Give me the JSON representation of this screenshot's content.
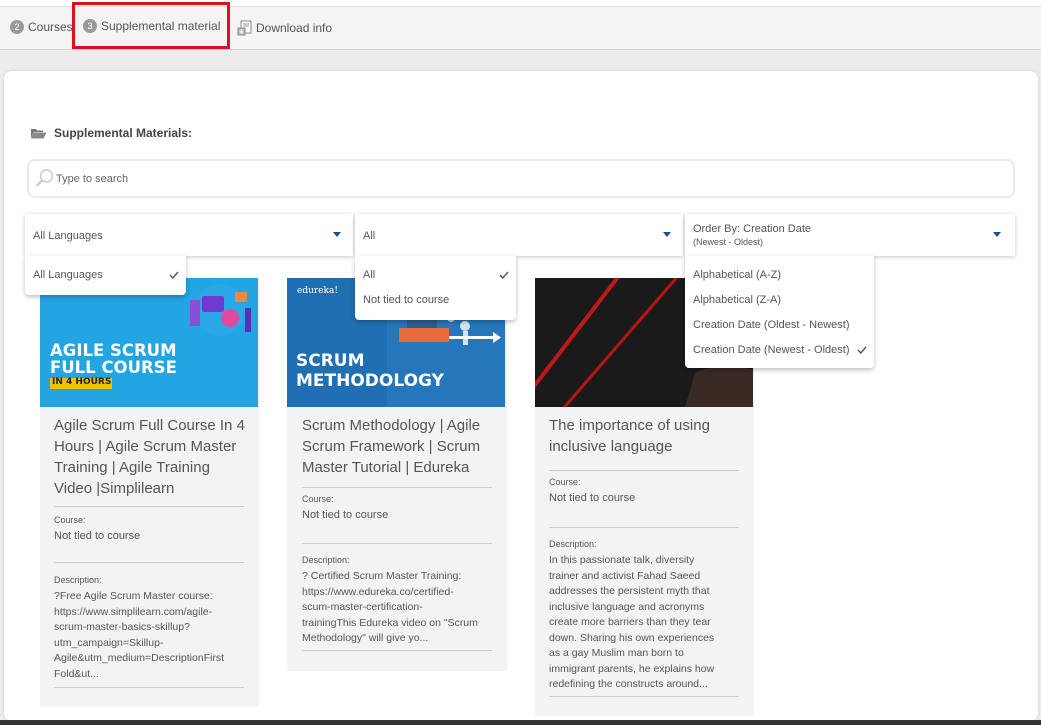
{
  "breadcrumb": {
    "steps": [
      {
        "num": "2",
        "label": "Courses"
      },
      {
        "num": "3",
        "label": "Supplemental material"
      },
      {
        "label": "Download info"
      }
    ]
  },
  "section": {
    "title": "Supplemental Materials:"
  },
  "search": {
    "placeholder": "Type to search"
  },
  "filters": {
    "language": {
      "selected": "All Languages",
      "options": [
        "All Languages"
      ]
    },
    "course": {
      "selected": "All",
      "options": [
        "All",
        "Not tied to course"
      ]
    },
    "order": {
      "selected": "Order By: Creation Date",
      "selected_sub": "(Newest - Oldest)",
      "options": [
        "Alphabetical (A-Z)",
        "Alphabetical (Z-A)",
        "Creation Date (Oldest - Newest)",
        "Creation Date (Newest - Oldest)"
      ]
    }
  },
  "materials": [
    {
      "thumb_heading_1": "AGILE SCRUM",
      "thumb_heading_2": "FULL COURSE",
      "thumb_badge": "IN 4 HOURS",
      "title_lines": [
        "Agile Scrum Full Course In 4",
        "Hours | Agile Scrum Master",
        "Training | Agile Training",
        "Video |Simplilearn"
      ],
      "course_label": "Course:",
      "course": "Not tied to course",
      "description_label": "Description:",
      "description_lines": [
        "?Free Agile Scrum Master course:",
        "https://www.simplilearn.com/agile-",
        "scrum-master-basics-skillup?",
        "utm_campaign=Skillup-",
        "Agile&utm_medium=DescriptionFirst",
        "Fold&ut..."
      ]
    },
    {
      "thumb_brand": "edureka!",
      "thumb_heading_1": "SCRUM",
      "thumb_heading_2": "METHODOLOGY",
      "title_lines": [
        "Scrum Methodology | Agile",
        "Scrum Framework | Scrum",
        "Master Tutorial | Edureka"
      ],
      "course_label": "Course:",
      "course": "Not tied to course",
      "description_label": "Description:",
      "description_lines": [
        "? Certified Scrum Master Training:",
        "https://www.edureka.co/certified-",
        "scum-master-certification-",
        "trainingThis Edureka video on \"Scrum",
        "Methodology\" will give yo..."
      ]
    },
    {
      "title_lines": [
        "The importance of using",
        "inclusive language"
      ],
      "course_label": "Course:",
      "course": "Not tied to course",
      "description_label": "Description:",
      "description_lines": [
        "In this passionate talk, diversity",
        "trainer and activist Fahad Saeed",
        "addresses the persistent myth that",
        "inclusive language and acronyms",
        "create more barriers than they tear",
        "down. Sharing his own experiences",
        "as a gay Muslim man born to",
        "immigrant parents, he explains how",
        "redefining the constructs around..."
      ]
    }
  ],
  "colors": {
    "accent": "#1a4f8a",
    "highlight": "#e0101a",
    "agile_bg": "#1e9ee0",
    "agile_badge": "#f2c200",
    "edureka_bg": "#1f6fb2"
  }
}
